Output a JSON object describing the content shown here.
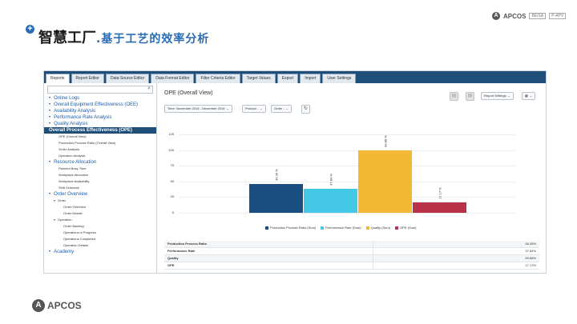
{
  "slide": {
    "title": "智慧工厂",
    "subtitle": ".基于工艺的效率分析",
    "top_logo": {
      "brand": "APCOS",
      "tags": [
        "BEISA",
        "P-APV"
      ]
    },
    "bottom_logo": {
      "brand": "APCOS"
    }
  },
  "app": {
    "tabs": [
      "Reports",
      "Report Editor",
      "Data Source Editor",
      "Data Format Editor",
      "Filter Criteria Editor",
      "Target Values",
      "Export",
      "Import",
      "User Settings"
    ],
    "active_tab": "Reports",
    "sidebar": [
      {
        "level": 1,
        "label": "Online Logs"
      },
      {
        "level": 1,
        "label": "Overall Equipment Effectiveness (OEE)"
      },
      {
        "level": 1,
        "label": "Availability Analysis"
      },
      {
        "level": 1,
        "label": "Performance Rate Analysis"
      },
      {
        "level": 1,
        "label": "Quality Analysis"
      },
      {
        "level": 1,
        "label": "Overall Process Effectiveness (OPE)",
        "selected": true
      },
      {
        "level": 2,
        "label": "OPE (Overall View)"
      },
      {
        "level": 2,
        "label": "Production Process Ratio (Overall View)"
      },
      {
        "level": 2,
        "label": "Order Analysis"
      },
      {
        "level": 2,
        "label": "Operation Analysis"
      },
      {
        "level": 1,
        "label": "Resource Allocation"
      },
      {
        "level": 2,
        "label": "Planned Busy Time"
      },
      {
        "level": 2,
        "label": "Workplace Allocation"
      },
      {
        "level": 2,
        "label": "Workplace Availability"
      },
      {
        "level": 2,
        "label": "Shift Schedule"
      },
      {
        "level": 1,
        "label": "Order Overview"
      },
      {
        "level": 3,
        "label": "Order"
      },
      {
        "level": 4,
        "label": "Order Overview"
      },
      {
        "level": 4,
        "label": "Order Details"
      },
      {
        "level": 3,
        "label": "Operation"
      },
      {
        "level": 4,
        "label": "Order Backlog"
      },
      {
        "level": 4,
        "label": "Operations in Progress"
      },
      {
        "level": 4,
        "label": "Operations Completed"
      },
      {
        "level": 4,
        "label": "Operation Details"
      },
      {
        "level": 1,
        "label": "Academy"
      }
    ],
    "view_title": "OPE (Overall View)",
    "filters": {
      "time": "Time: November 2016 - December 2016",
      "product": "Product -",
      "order": "Order -"
    },
    "report_settings": "Report Settings",
    "icons": {
      "search": "search-icon",
      "refresh": "refresh-icon",
      "print": "print-icon",
      "export": "excel-export-icon"
    }
  },
  "chart_data": {
    "type": "bar",
    "title": "",
    "xlabel": "",
    "ylabel": "",
    "ylim": [
      0,
      125
    ],
    "yticks": [
      "125",
      "100",
      "75",
      "50",
      "25",
      "0"
    ],
    "series": [
      {
        "name": "Production Process Ratio (Sum)",
        "value": 46.35,
        "label": "46.35 %",
        "color": "#1a4d80"
      },
      {
        "name": "Performance Rate (Sum)",
        "value": 37.84,
        "label": "37.84 %",
        "color": "#45c8e6"
      },
      {
        "name": "Quality (Sum)",
        "value": 99.88,
        "label": "99.88 %",
        "color": "#f3b935"
      },
      {
        "name": "OPE (Sum)",
        "value": 17.17,
        "label": "17.17 %",
        "color": "#b8334a"
      }
    ]
  },
  "table": [
    {
      "name": "Production Process Ratio",
      "value": "46.35%"
    },
    {
      "name": "Performance Rate",
      "value": "37.84%"
    },
    {
      "name": "Quality",
      "value": "99.88%"
    },
    {
      "name": "OPE",
      "value": "17.17%"
    }
  ]
}
